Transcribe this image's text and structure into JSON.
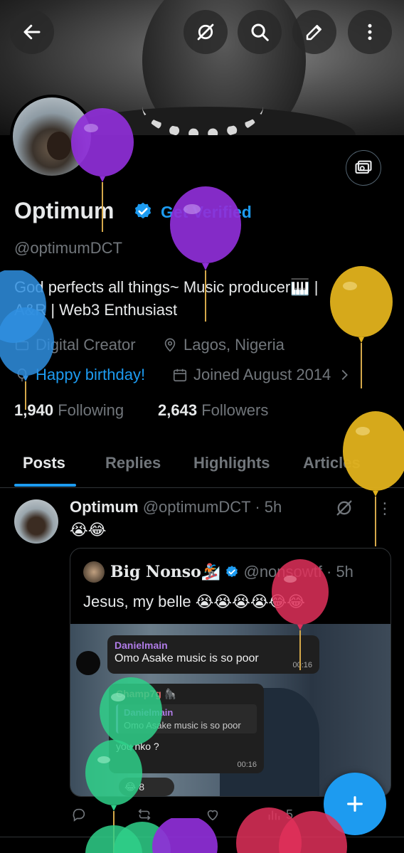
{
  "header": {
    "back_label": "Back",
    "grok_label": "Grok",
    "search_label": "Search",
    "edit_label": "Edit",
    "more_label": "More"
  },
  "profile": {
    "name": "Optimum",
    "get_verified": "Get Verified",
    "handle": "@optimumDCT",
    "bio_line1": "God perfects all things~ Music producer🎹 |",
    "bio_line2": "A&R | Web3 Enthusiast",
    "category": "Digital Creator",
    "location": "Lagos, Nigeria",
    "birthday": "Happy birthday!",
    "joined": "Joined August 2014",
    "following_count": "1,940",
    "following_label": "Following",
    "followers_count": "2,643",
    "followers_label": "Followers"
  },
  "tabs": [
    {
      "label": "Posts"
    },
    {
      "label": "Replies"
    },
    {
      "label": "Highlights"
    },
    {
      "label": "Articles"
    }
  ],
  "post": {
    "author": "Optimum",
    "handle": "@optimumDCT",
    "time": "· 5h",
    "text": "😭😂",
    "quote": {
      "author": "Big Nonso🏂",
      "handle": "@nonsowtf",
      "time": "· 5h",
      "text": "Jesus, my belle 😭😭😭😭😂😂",
      "media": {
        "msg1_name": "Danielmain",
        "msg1_text": "Omo Asake music is so poor",
        "msg1_time": "00:16",
        "msg2_name": "Champ7g 🦍",
        "msg2_reply_name": "Danielmain",
        "msg2_reply_text": "Omo Asake music is so poor",
        "msg2_text": "you nko ?",
        "msg2_time": "00:16",
        "reaction": "😂 8"
      }
    },
    "views": "5"
  },
  "fab_label": "+",
  "colors": {
    "accent": "#1d9bf0",
    "background": "#000000",
    "muted": "#71767b",
    "text": "#e7e9ea"
  }
}
